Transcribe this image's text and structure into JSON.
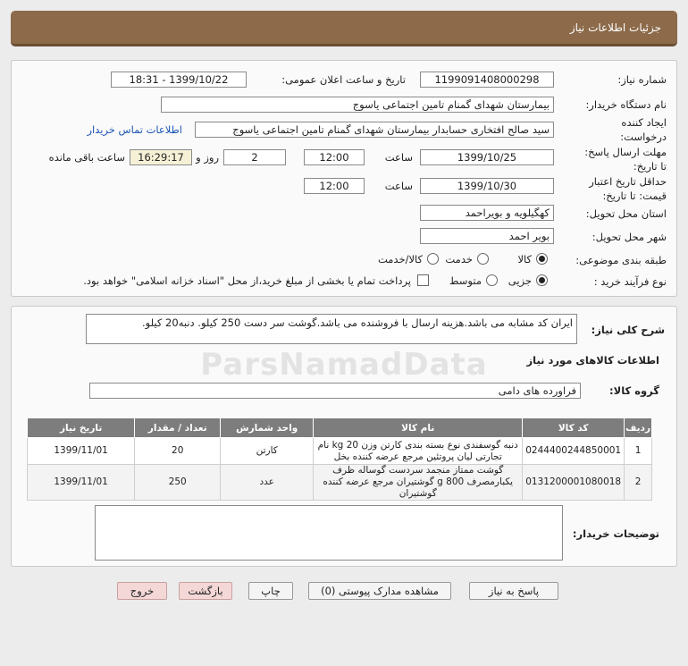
{
  "page": {
    "title": "جزئیات اطلاعات نیاز"
  },
  "header": {
    "need_number_label": "شماره نیاز:",
    "need_number": "1199091408000298",
    "announce_label": "تاریخ و ساعت اعلان عمومی:",
    "announce_value": "1399/10/22 - 18:31",
    "buyer_label": "نام دستگاه خریدار:",
    "buyer": "بیمارستان شهدای گمنام تامین اجتماعی یاسوج",
    "creator_label_1": "ایجاد کننده",
    "creator_label_2": "درخواست:",
    "creator": "سید صالح افتخاری حسابدار بیمارستان شهدای گمنام تامین اجتماعی یاسوج",
    "contact_link": "اطلاعات تماس خریدار",
    "deadline_label_1": "مهلت ارسال پاسخ:",
    "deadline_label_2": "تا تاریخ:",
    "deadline_date": "1399/10/25",
    "time_label": "ساعت",
    "deadline_time": "12:00",
    "days_value": "2",
    "days_label": "روز و",
    "remaining_time": "16:29:17",
    "remaining_label": "ساعت باقی مانده",
    "validity_label_1": "حداقل تاریخ اعتبار",
    "validity_label_2": "قیمت: تا تاریخ:",
    "validity_date": "1399/10/30",
    "validity_time_label": "ساعت",
    "validity_time": "12:00",
    "province_label": "استان محل تحویل:",
    "province": "کهگیلویه و بویراحمد",
    "city_label": "شهر محل تحویل:",
    "city": "بویر احمد",
    "category_label": "طبقه بندی موضوعی:",
    "category_options": [
      "کالا",
      "خدمت",
      "کالا/خدمت"
    ],
    "category_selected": "کالا",
    "process_label": "نوع فرآیند خرید :",
    "process_options": [
      "جزیی",
      "متوسط"
    ],
    "process_selected": "جزیی",
    "payment_note": "پرداخت تمام یا بخشی از مبلغ خرید،از محل \"اسناد خزانه اسلامی\" خواهد بود."
  },
  "description": {
    "label": "شرح کلی نیاز:",
    "text": "ایران کد مشابه می باشد.هزینه ارسال با فروشنده می باشد.گوشت سر دست 250 کیلو. دنبه20 کیلو."
  },
  "goods_section": {
    "title": "اطلاعات کالاهای مورد نیاز",
    "group_label": "گروه کالا:",
    "group_value": "فراورده های دامی"
  },
  "table": {
    "columns": [
      "ردیف",
      "کد کالا",
      "نام کالا",
      "واحد شمارش",
      "تعداد / مقدار",
      "تاریخ نیاز"
    ],
    "rows": [
      {
        "row": "1",
        "code": "0244400244850001",
        "name": "دنبه گوسفندی نوع بسته بندی کارتن وزن 20 kg نام تجارتی لیان پروتئین مرجع عرضه کننده بخل",
        "unit": "کارتن",
        "qty": "20",
        "date": "1399/11/01"
      },
      {
        "row": "2",
        "code": "0131200001080018",
        "name": "گوشت ممتاز منجمد سردست گوساله ظرف یکبارمصرف 800 g گوشتیران مرجع عرضه کننده گوشتیران",
        "unit": "عدد",
        "qty": "250",
        "date": "1399/11/01"
      }
    ]
  },
  "buyer_notes": {
    "label": "توضیحات خریدار:",
    "text": ""
  },
  "buttons": {
    "reply": "پاسخ به نیاز",
    "view_docs": "مشاهده مدارک پیوستی (0)",
    "print": "چاپ",
    "back": "بازگشت",
    "exit": "خروج"
  },
  "watermark": "ParsNamadData"
}
